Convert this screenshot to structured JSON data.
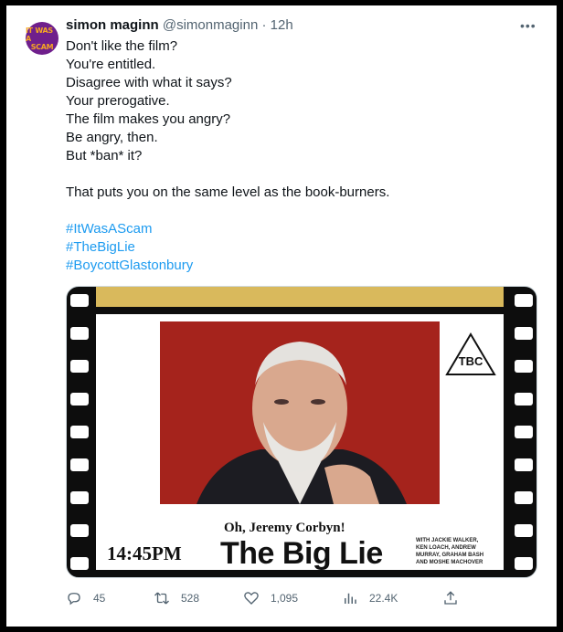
{
  "tweet": {
    "avatar_text_1": "IT WAS A",
    "avatar_text_2": "SCAM",
    "display_name": "simon maginn",
    "handle": "@simonmaginn",
    "separator": "·",
    "time": "12h",
    "lines": [
      "Don't like the film?",
      "You're entitled.",
      "Disagree with what it says?",
      "Your prerogative.",
      "The film makes you angry?",
      "Be angry, then.",
      "But *ban* it?",
      "",
      "That puts you on the same level as the book-burners.",
      ""
    ],
    "hashtags": [
      "#ItWasAScam",
      "#TheBigLie",
      "#BoycottGlastonbury"
    ]
  },
  "poster": {
    "rating": "TBC",
    "subtitle": "Oh, Jeremy Corbyn!",
    "time": "14:45PM",
    "title": "The Big Lie",
    "credits": [
      "WITH JACKIE WALKER,",
      "KEN LOACH, ANDREW",
      "MURRAY, GRAHAM BASH",
      "AND MOSHE MACHOVER"
    ]
  },
  "actions": {
    "replies": "45",
    "retweets": "528",
    "likes": "1,095",
    "views": "22.4K"
  },
  "colors": {
    "link": "#1d9bf0",
    "muted": "#536471",
    "text": "#0f1419",
    "poster_red": "#a5231c",
    "strip_gold": "#d9b95c"
  },
  "icons": [
    "more-icon",
    "reply-icon",
    "retweet-icon",
    "like-icon",
    "views-icon",
    "share-icon"
  ]
}
